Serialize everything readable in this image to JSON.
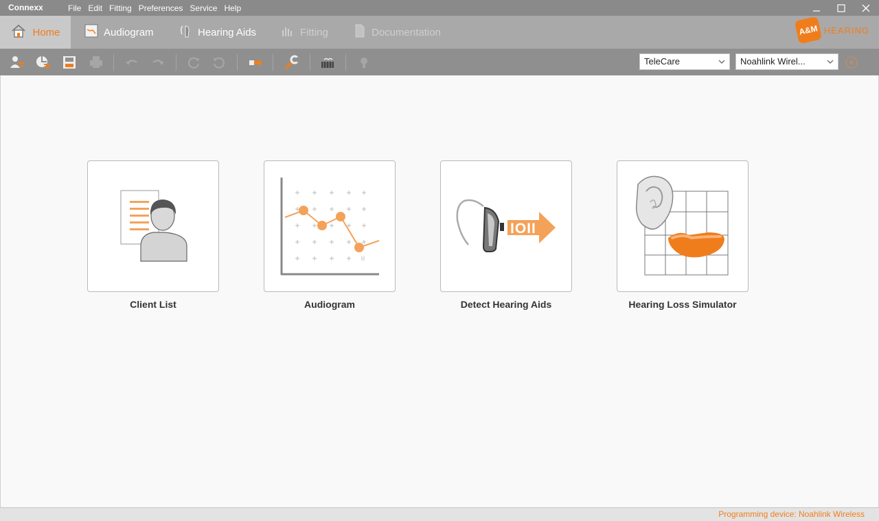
{
  "app": {
    "title": "Connexx"
  },
  "menu": [
    "File",
    "Edit",
    "Fitting",
    "Preferences",
    "Service",
    "Help"
  ],
  "tabs": [
    {
      "label": "Home",
      "icon": "home-icon",
      "state": "active"
    },
    {
      "label": "Audiogram",
      "icon": "audiogram-icon",
      "state": "normal"
    },
    {
      "label": "Hearing Aids",
      "icon": "hearing-aid-icon",
      "state": "normal"
    },
    {
      "label": "Fitting",
      "icon": "fitting-icon",
      "state": "disabled"
    },
    {
      "label": "Documentation",
      "icon": "document-icon",
      "state": "disabled"
    }
  ],
  "logo": {
    "badge": "A&M",
    "text": "HEARING"
  },
  "toolbar": {
    "buttons": [
      "client-list-icon",
      "new-client-icon",
      "save-icon",
      "print-icon",
      "undo-icon",
      "redo-icon",
      "refresh-icon",
      "reset-icon",
      "export-icon",
      "wrench-icon",
      "device-icon",
      "lightbulb-icon"
    ],
    "selects": [
      {
        "value": "TeleCare"
      },
      {
        "value": "Noahlink Wirel..."
      }
    ]
  },
  "tiles": [
    {
      "label": "Client List",
      "icon": "client-list-icon"
    },
    {
      "label": "Audiogram",
      "icon": "audiogram-chart-icon"
    },
    {
      "label": "Detect Hearing Aids",
      "icon": "detect-hearing-aids-icon"
    },
    {
      "label": "Hearing Loss Simulator",
      "icon": "hearing-loss-simulator-icon"
    }
  ],
  "status": {
    "text": "Programming device: Noahlink Wireless"
  },
  "colors": {
    "accent": "#f07d1c",
    "titlebar": "#8a8a8a",
    "tabbar": "#a9a9a9",
    "toolbar": "#8f8f8f"
  }
}
